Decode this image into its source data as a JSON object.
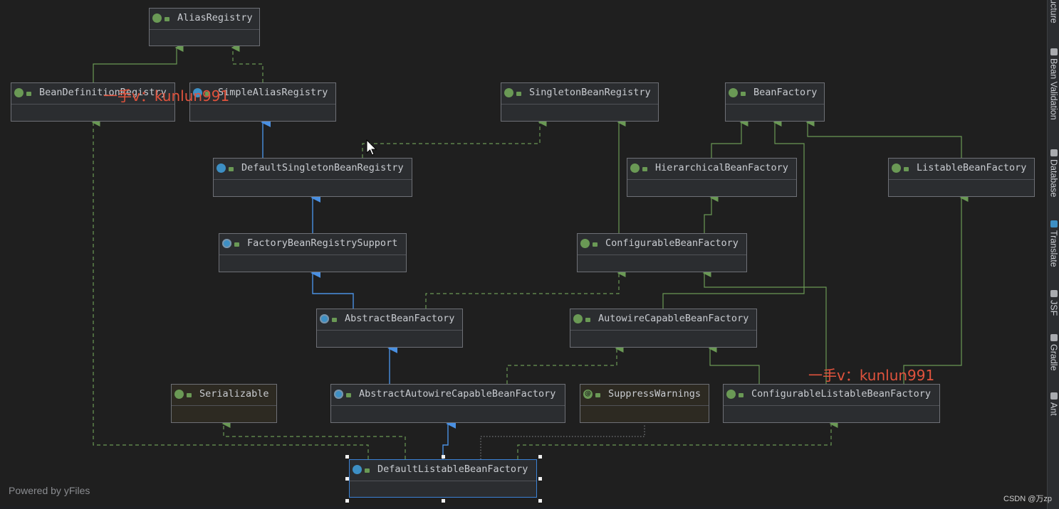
{
  "nodes": {
    "alias_registry": "AliasRegistry",
    "bean_definition_registry": "BeanDefinitionRegistry",
    "simple_alias_registry": "SimpleAliasRegistry",
    "singleton_bean_registry": "SingletonBeanRegistry",
    "bean_factory": "BeanFactory",
    "default_singleton_bean_registry": "DefaultSingletonBeanRegistry",
    "hierarchical_bean_factory": "HierarchicalBeanFactory",
    "listable_bean_factory": "ListableBeanFactory",
    "factory_bean_registry_support": "FactoryBeanRegistrySupport",
    "configurable_bean_factory": "ConfigurableBeanFactory",
    "abstract_bean_factory": "AbstractBeanFactory",
    "autowire_capable_bean_factory": "AutowireCapableBeanFactory",
    "serializable": "Serializable",
    "abstract_autowire_capable_bean_factory": "AbstractAutowireCapableBeanFactory",
    "suppress_warnings": "SuppressWarnings",
    "configurable_listable_bean_factory": "ConfigurableListableBeanFactory",
    "default_listable_bean_factory": "DefaultListableBeanFactory"
  },
  "watermarks": [
    "一手v：kunlun991",
    "一手v：kunlun991"
  ],
  "footer": {
    "powered_by": "Powered by yFiles",
    "credit": "CSDN @万zp"
  },
  "sidebar": {
    "items": [
      "ucture",
      "Bean Validation",
      "Database",
      "Translate",
      "JSF",
      "Gradle",
      "Ant"
    ]
  },
  "colors": {
    "canvas": "#1f1f1f",
    "node_fill": "#2b2d30",
    "interface_icon": "#6a9955",
    "class_icon": "#3d8fc4",
    "extends_edge": "#4a90e2",
    "implements_edge": "#6a9955",
    "selection": "#3b82d6",
    "watermark": "#e0533d"
  },
  "icons": {
    "interface": "interface-icon",
    "class": "class-icon",
    "abstract_class": "abstract-class-icon",
    "annotation": "annotation-icon",
    "visibility": "public-lock-icon"
  }
}
